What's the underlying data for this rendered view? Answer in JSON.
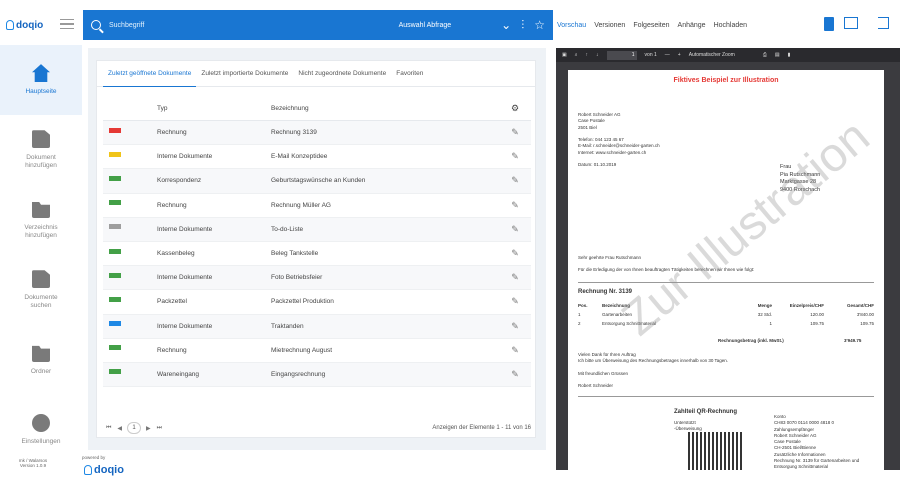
{
  "brand": {
    "name": "doqio"
  },
  "search": {
    "placeholder": "Suchbegriff",
    "selection": "Auswahl Abfrage"
  },
  "viewer_tabs": [
    "Vorschau",
    "Versionen",
    "Folgeseiten",
    "Anhänge",
    "Hochladen"
  ],
  "sidebar": {
    "items": [
      {
        "label": "Hauptseite",
        "icon": "home-icon"
      },
      {
        "label": "Dokument\nhinzufügen",
        "icon": "add-document-icon"
      },
      {
        "label": "Verzeichnis\nhinzufügen",
        "icon": "add-folder-icon"
      },
      {
        "label": "Dokumente\nsuchen",
        "icon": "search-document-icon"
      },
      {
        "label": "Ordner",
        "icon": "folder-icon"
      },
      {
        "label": "Einstellungen",
        "icon": "settings-icon"
      }
    ]
  },
  "footer": {
    "version_line1": "mk / Walarsos",
    "version_line2": "Version 1.0.9",
    "powered_by": "powered by"
  },
  "main": {
    "tabs": [
      "Zuletzt geöffnete Dokumente",
      "Zuletzt importierte Dokumente",
      "Nicht zugeordnete Dokumente",
      "Favoriten"
    ],
    "columns": {
      "typ": "Typ",
      "bezeichnung": "Bezeichnung"
    },
    "rows": [
      {
        "typ": "Rechnung",
        "bezeichnung": "Rechnung 3139",
        "file": "PDF",
        "color": "#e53935"
      },
      {
        "typ": "Interne Dokumente",
        "bezeichnung": "E-Mail Konzeptidee",
        "file": "MSG",
        "color": "#f0c419"
      },
      {
        "typ": "Korrespondenz",
        "bezeichnung": "Geburtstagswünsche an Kunden",
        "file": "JPG",
        "color": "#43a047"
      },
      {
        "typ": "Rechnung",
        "bezeichnung": "Rechnung Müller AG",
        "file": "JPG",
        "color": "#43a047"
      },
      {
        "typ": "Interne Dokumente",
        "bezeichnung": "To-do-Liste",
        "file": "TXT",
        "color": "#9e9e9e"
      },
      {
        "typ": "Kassenbeleg",
        "bezeichnung": "Beleg Tankstelle",
        "file": "JPG",
        "color": "#43a047"
      },
      {
        "typ": "Interne Dokumente",
        "bezeichnung": "Foto Betriebsfeier",
        "file": "JPG",
        "color": "#43a047"
      },
      {
        "typ": "Packzettel",
        "bezeichnung": "Packzettel Produktion",
        "file": "JPG",
        "color": "#43a047"
      },
      {
        "typ": "Interne Dokumente",
        "bezeichnung": "Traktanden",
        "file": "DOC",
        "color": "#1e88e5"
      },
      {
        "typ": "Rechnung",
        "bezeichnung": "Mietrechnung August",
        "file": "JPG",
        "color": "#43a047"
      },
      {
        "typ": "Wareneingang",
        "bezeichnung": "Eingangsrechnung",
        "file": "JPG",
        "color": "#43a047"
      }
    ],
    "pager": {
      "page": "1",
      "summary": "Anzeigen der Elemente 1 - 11 von 16"
    }
  },
  "pdf": {
    "page_of": "von 1",
    "page_input": "1",
    "zoom": "Automatischer Zoom",
    "title": "Fiktives Beispiel zur Illustration",
    "sender": [
      "Robert Schneider AG",
      "Case Postale",
      "2501 Biel",
      "",
      "Telefon:   044 123 45 67",
      "E-Mail:    r.schneider@schneider-garten.ch",
      "Internet:  www.schneider-garten.ch",
      "",
      "Datum: 01.10.2019"
    ],
    "recipient": [
      "Frau",
      "Pia Rutschmann",
      "Marktgasse 28",
      "9400 Rorschach"
    ],
    "greeting": "Sehr geehrte Frau Rutschmann",
    "intro": "Für die Erledigung der von Ihnen beauftragten Tätigkeiten berechnen wir Ihnen wie folgt:",
    "invoice_title": "Rechnung Nr. 3139",
    "pos_headers": [
      "Pos.",
      "Bezeichnung",
      "Menge",
      "Einzelpreis/CHF",
      "Gesamt/CHF"
    ],
    "positions": [
      [
        "1",
        "Gartenarbeiten",
        "32 Std.",
        "120.00",
        "3'840.00"
      ],
      [
        "2",
        "Entsorgung Schnittmaterial",
        "1",
        "109.75",
        "109.75"
      ]
    ],
    "total_label": "Rechnungsbetrag (inkl. MwSt.)",
    "total": "3'949.75",
    "closing": [
      "Vielen Dank für Ihren Auftrag",
      "Ich bitte um Überweisung des Rechnungsbetrages innerhalb von 30 Tagen.",
      "",
      "Mit freundlichen Grüssen",
      "",
      "Robert Schneider"
    ],
    "qr_title": "Zahlteil QR-Rechnung",
    "qr_left": [
      "Unterstützt",
      "-Überweisung"
    ],
    "qr_right": [
      "Konto",
      "CH83 0070 0114 0000 4818 0",
      "Zahlungsempfänger",
      "Robert Schneider AG",
      "Case Postale",
      "CH-2501 Biel/Bienne",
      "Zusätzliche Informationen",
      "Rechnung Nr. 3139 für Gartenarbeiten und",
      "Entsorgung Schnittmaterial",
      "Zahlungspflichtiger",
      "Pia Rutschmann",
      "Marktgasse 28"
    ],
    "watermark": "Zur Illustration"
  }
}
